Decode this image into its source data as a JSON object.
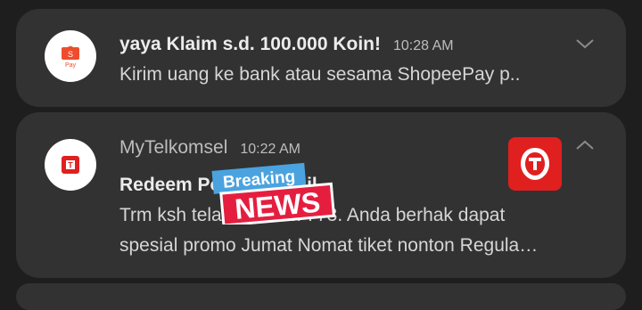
{
  "notifications": [
    {
      "app_icon": "shopee-pay-icon",
      "title": "yaya Klaim s.d. 100.000 Koin!",
      "time": "10:28 AM",
      "body": "Kirim uang ke bank atau sesama ShopeePay p..",
      "icon_label": "Pay"
    },
    {
      "app_icon": "telkomsel-icon",
      "app_name": "MyTelkomsel",
      "time": "10:22 AM",
      "subject": "Redeem Poin Berhasil",
      "line1": "Trm ksh telah redeem 773. Anda berhak dapat",
      "line2": "spesial promo Jumat Nomat tiket nonton Regula…",
      "large_icon": "telkomsel-logo-icon"
    }
  ],
  "overlay": {
    "top": "Breaking",
    "bottom": "NEWS"
  },
  "colors": {
    "background": "#1e1e1e",
    "card": "#323232",
    "shopee_orange": "#ee4d2d",
    "telkomsel_red": "#e0201f"
  }
}
